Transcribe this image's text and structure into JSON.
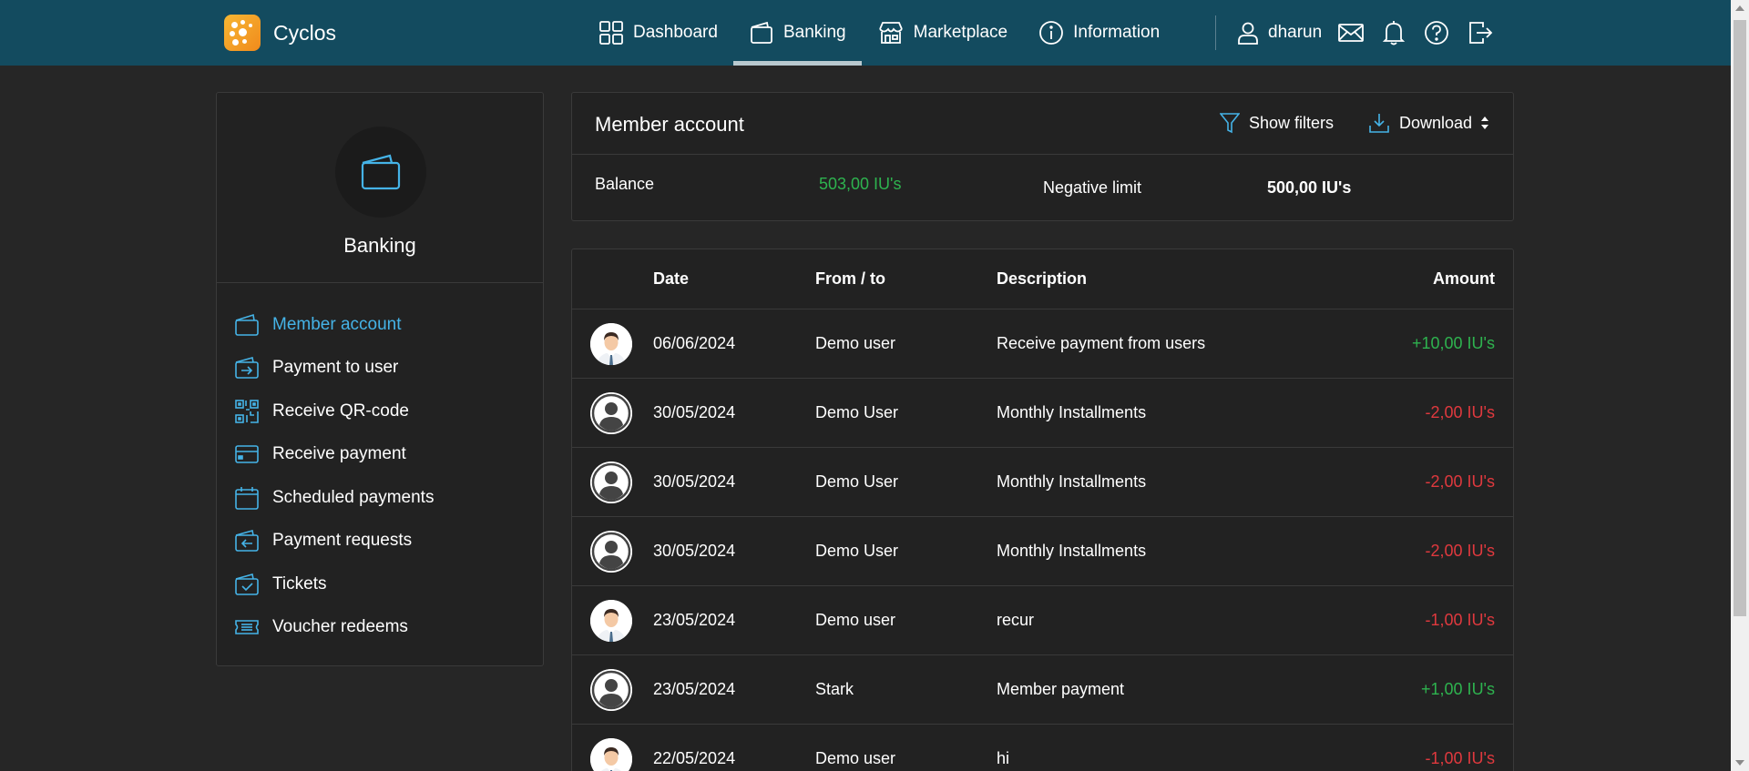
{
  "app": {
    "name": "Cyclos"
  },
  "nav": [
    {
      "label": "Dashboard",
      "icon": "dashboard-icon"
    },
    {
      "label": "Banking",
      "icon": "wallet-icon",
      "active": true
    },
    {
      "label": "Marketplace",
      "icon": "store-icon"
    },
    {
      "label": "Information",
      "icon": "info-icon"
    }
  ],
  "user": {
    "name": "dharun"
  },
  "sidebar": {
    "title": "Banking",
    "items": [
      {
        "label": "Member account",
        "icon": "wallet-icon",
        "active": true
      },
      {
        "label": "Payment to user",
        "icon": "payment-to-user-icon"
      },
      {
        "label": "Receive QR-code",
        "icon": "qr-code-icon"
      },
      {
        "label": "Receive payment",
        "icon": "credit-card-icon"
      },
      {
        "label": "Scheduled payments",
        "icon": "calendar-icon"
      },
      {
        "label": "Payment requests",
        "icon": "payment-request-icon"
      },
      {
        "label": "Tickets",
        "icon": "ticket-check-icon"
      },
      {
        "label": "Voucher redeems",
        "icon": "voucher-icon"
      }
    ]
  },
  "account": {
    "title": "Member account",
    "show_filters": "Show filters",
    "download": "Download",
    "balance_label": "Balance",
    "balance_value": "503,00 IU's",
    "negative_limit_label": "Negative limit",
    "negative_limit_value": "500,00 IU's"
  },
  "table": {
    "headers": {
      "date": "Date",
      "from_to": "From / to",
      "description": "Description",
      "amount": "Amount"
    },
    "rows": [
      {
        "avatar": "person-photo",
        "date": "06/06/2024",
        "from_to": "Demo user",
        "description": "Receive payment from users",
        "amount": "+10,00 IU's",
        "sign": "pos"
      },
      {
        "avatar": "default-avatar",
        "date": "30/05/2024",
        "from_to": "Demo User",
        "description": "Monthly Installments",
        "amount": "-2,00 IU's",
        "sign": "neg"
      },
      {
        "avatar": "default-avatar",
        "date": "30/05/2024",
        "from_to": "Demo User",
        "description": "Monthly Installments",
        "amount": "-2,00 IU's",
        "sign": "neg"
      },
      {
        "avatar": "default-avatar",
        "date": "30/05/2024",
        "from_to": "Demo User",
        "description": "Monthly Installments",
        "amount": "-2,00 IU's",
        "sign": "neg"
      },
      {
        "avatar": "person-photo",
        "date": "23/05/2024",
        "from_to": "Demo user",
        "description": "recur",
        "amount": "-1,00 IU's",
        "sign": "neg"
      },
      {
        "avatar": "default-avatar",
        "date": "23/05/2024",
        "from_to": "Stark",
        "description": "Member payment",
        "amount": "+1,00 IU's",
        "sign": "pos"
      },
      {
        "avatar": "person-photo",
        "date": "22/05/2024",
        "from_to": "Demo user",
        "description": "hi",
        "amount": "-1,00 IU's",
        "sign": "neg"
      }
    ]
  },
  "colors": {
    "topbar": "#134b5f",
    "accent": "#45b3e7",
    "positive": "#2eb34f",
    "negative": "#e0393e",
    "background": "#262626",
    "panel": "#222222"
  }
}
